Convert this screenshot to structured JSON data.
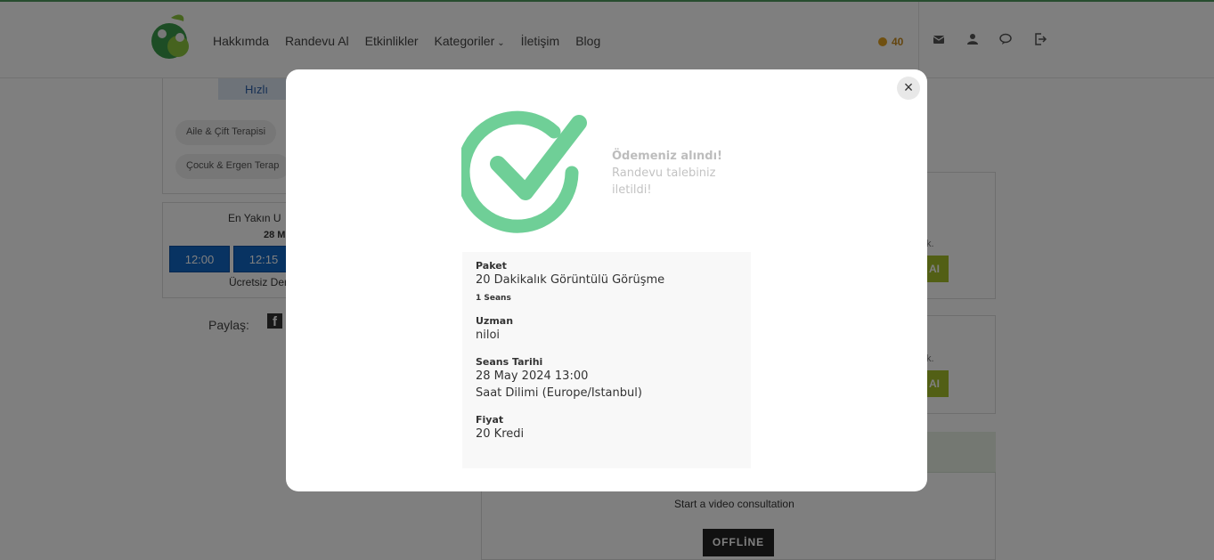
{
  "nav": {
    "links": [
      "Hakkımda",
      "Randevu Al",
      "Etkinlikler",
      "Kategoriler",
      "İletişim",
      "Blog"
    ],
    "credits": "40",
    "icons": [
      "mail-icon",
      "user-icon",
      "chat-icon",
      "logout-icon"
    ]
  },
  "background": {
    "quick_button": "Hızlı",
    "tags": [
      "Aile & Çift Terapisi",
      "Çocuk & Ergen Terap"
    ],
    "slots_title": "En Yakın U",
    "slots_date": "28 M",
    "slots": [
      "12:00",
      "12:15"
    ],
    "free_text": "Ücretsiz Der",
    "share_label": "Paylaş:",
    "right_button": "AI",
    "right_small": "k.",
    "video_text": "Start a video consultation",
    "offline_label": "OFFLİNE"
  },
  "modal": {
    "success_title": "Ödemeniz alındı!",
    "success_line1": "Randevu talebiniz",
    "success_line2": "iletildi!",
    "colors": {
      "check": "#6fcf97"
    },
    "package_label": "Paket",
    "package_value": "20 Dakikalık Görüntülü Görüşme",
    "package_sessions": "1 Seans",
    "expert_label": "Uzman",
    "expert_value": "niloi",
    "date_label": "Seans Tarihi",
    "date_value": "28 May 2024 13:00",
    "timezone_value": "Saat Dilimi (Europe/Istanbul)",
    "price_label": "Fiyat",
    "price_value": "20 Kredi"
  }
}
